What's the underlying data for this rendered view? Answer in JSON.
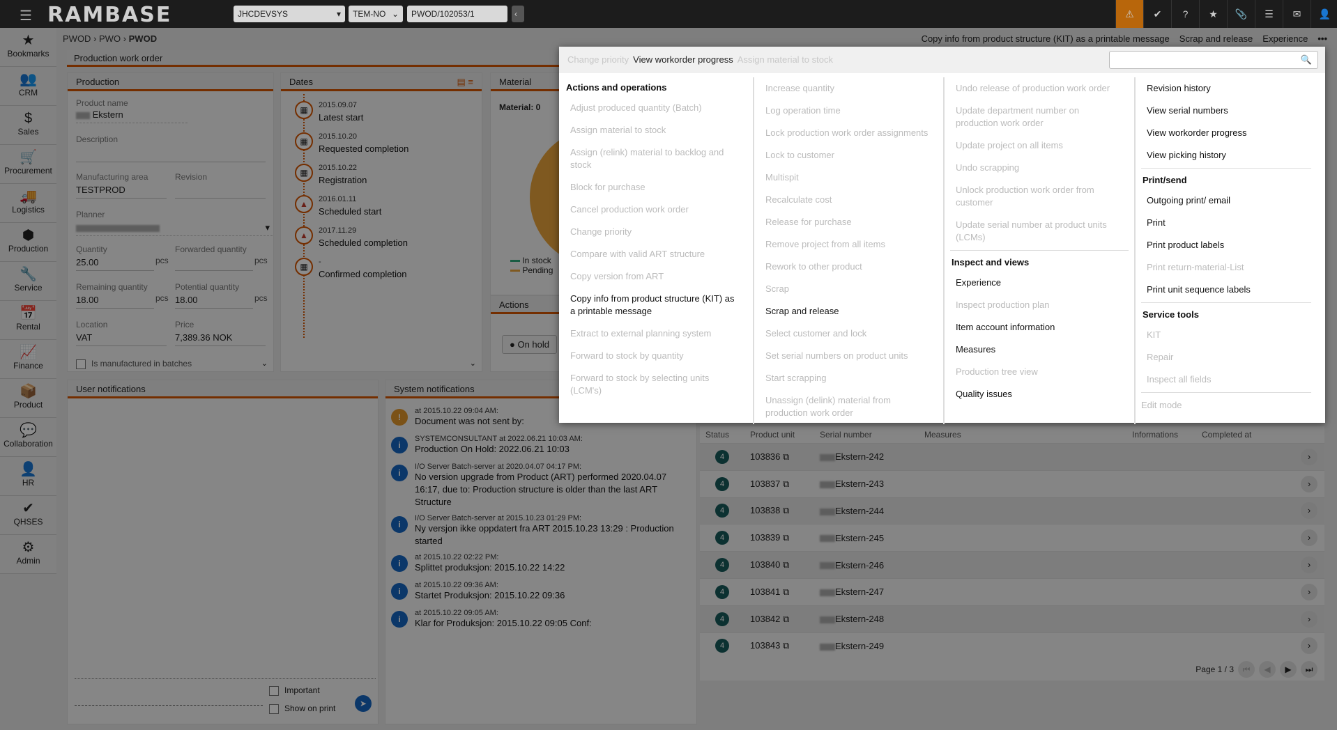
{
  "topbar": {
    "logo": "RAMBASE",
    "company": "JHCDEVSYS",
    "region": "TEM-NO",
    "document": "PWOD/102053/1",
    "back": "‹",
    "icons": [
      {
        "name": "warning-icon",
        "glyph": "⚠",
        "active": true
      },
      {
        "name": "badge-check-icon",
        "glyph": "✔"
      },
      {
        "name": "help-icon",
        "glyph": "?"
      },
      {
        "name": "star-icon",
        "glyph": "★"
      },
      {
        "name": "paperclip-icon",
        "glyph": "📎"
      },
      {
        "name": "list-icon",
        "glyph": "☰"
      },
      {
        "name": "mail-icon",
        "glyph": "✉"
      },
      {
        "name": "user-icon",
        "glyph": "👤"
      }
    ],
    "accent": "#d35400"
  },
  "sidebar": {
    "items": [
      {
        "label": "Bookmarks",
        "icon": "★"
      },
      {
        "label": "CRM",
        "icon": "👥"
      },
      {
        "label": "Sales",
        "icon": "$"
      },
      {
        "label": "Procurement",
        "icon": "🛒"
      },
      {
        "label": "Logistics",
        "icon": "🚚"
      },
      {
        "label": "Production",
        "icon": "⬢"
      },
      {
        "label": "Service",
        "icon": "🔧"
      },
      {
        "label": "Rental",
        "icon": "📅"
      },
      {
        "label": "Finance",
        "icon": "📈"
      },
      {
        "label": "Product",
        "icon": "📦"
      },
      {
        "label": "Collaboration",
        "icon": "💬"
      },
      {
        "label": "HR",
        "icon": "👤"
      },
      {
        "label": "QHSES",
        "icon": "✔"
      },
      {
        "label": "Admin",
        "icon": "⚙"
      }
    ]
  },
  "breadcrumb": [
    "PWOD",
    "PWO",
    "PWOD"
  ],
  "actionbar": [
    "Copy info from product structure (KIT) as a printable message",
    "Scrap and release",
    "Experience",
    "•••"
  ],
  "main": {
    "title": "Production work order",
    "production": {
      "title": "Production",
      "product_name_label": "Product name",
      "product_name": "Ekstern",
      "description_label": "Description",
      "manufacturing_area_label": "Manufacturing area",
      "manufacturing_area": "TESTPROD",
      "revision_label": "Revision",
      "planner_label": "Planner",
      "quantity_label": "Quantity",
      "quantity": "25.00",
      "forwarded_label": "Forwarded quantity",
      "remaining_label": "Remaining quantity",
      "remaining": "18.00",
      "potential_label": "Potential quantity",
      "potential": "18.00",
      "unit": "pcs",
      "location_label": "Location",
      "location": "VAT",
      "price_label": "Price",
      "price": "7,389.36 NOK",
      "batches_label": "Is manufactured in batches"
    },
    "dates": {
      "title": "Dates",
      "items": [
        {
          "date": "2015.09.07",
          "label": "Latest start",
          "icon": "calendar"
        },
        {
          "date": "2015.10.20",
          "label": "Requested completion",
          "icon": "calendar"
        },
        {
          "date": "2015.10.22",
          "label": "Registration",
          "icon": "calendar"
        },
        {
          "date": "2016.01.11",
          "label": "Scheduled start",
          "icon": "warning"
        },
        {
          "date": "2017.11.29",
          "label": "Scheduled completion",
          "icon": "warning"
        },
        {
          "date": "-",
          "label": "Confirmed completion",
          "icon": "calendar"
        }
      ]
    },
    "material": {
      "title": "Material",
      "summary": "Material: 0",
      "legend": [
        "In stock",
        "Pending"
      ]
    },
    "actions": {
      "title": "Actions",
      "onhold": "On hold"
    },
    "user_notifications": {
      "title": "User notifications",
      "important": "Important",
      "show_on_print": "Show on print"
    },
    "system_notifications": {
      "title": "System notifications",
      "items": [
        {
          "type": "warning",
          "header": "at 2015.10.22 09:04 AM:",
          "body": "Document was not sent by:"
        },
        {
          "type": "info",
          "header": "SYSTEMCONSULTANT at 2022.06.21 10:03 AM:",
          "body": "Production On Hold: 2022.06.21 10:03"
        },
        {
          "type": "info",
          "header": "I/O Server Batch-server at 2020.04.07 04:17 PM:",
          "body": "No version upgrade from Product (ART) performed 2020.04.07 16:17, due to: Production structure is older than the last ART Structure"
        },
        {
          "type": "info",
          "header": "I/O Server Batch-server at 2015.10.23 01:29 PM:",
          "body": "Ny versjon ikke oppdatert fra ART 2015.10.23 13:29 : Production started"
        },
        {
          "type": "info",
          "header": "at 2015.10.22 02:22 PM:",
          "body": "Splittet produksjon: 2015.10.22 14:22"
        },
        {
          "type": "info",
          "header": "at 2015.10.22 09:36 AM:",
          "body": "Startet Produksjon: 2015.10.22 09:36"
        },
        {
          "type": "info",
          "header": "at 2015.10.22 09:05 AM:",
          "body": "Klar for Produksjon: 2015.10.22 09:05  Conf:"
        }
      ]
    },
    "grid": {
      "columns": [
        "Status",
        "Product unit",
        "Serial number",
        "Measures",
        "Informations",
        "Completed at"
      ],
      "rows": [
        {
          "status": "4",
          "unit": "103836",
          "serial": "Ekstern-242"
        },
        {
          "status": "4",
          "unit": "103837",
          "serial": "Ekstern-243"
        },
        {
          "status": "4",
          "unit": "103838",
          "serial": "Ekstern-244"
        },
        {
          "status": "4",
          "unit": "103839",
          "serial": "Ekstern-245"
        },
        {
          "status": "4",
          "unit": "103840",
          "serial": "Ekstern-246"
        },
        {
          "status": "4",
          "unit": "103841",
          "serial": "Ekstern-247"
        },
        {
          "status": "4",
          "unit": "103842",
          "serial": "Ekstern-248"
        },
        {
          "status": "4",
          "unit": "103843",
          "serial": "Ekstern-249"
        }
      ],
      "pager": "Page 1 / 3"
    }
  },
  "popup": {
    "recent": [
      {
        "label": "Change priority",
        "disabled": true
      },
      {
        "label": "View workorder progress",
        "disabled": false
      },
      {
        "label": "Assign material to stock",
        "disabled": true
      }
    ],
    "search_value": "",
    "columns": [
      [
        {
          "group": "Actions and operations",
          "items": [
            {
              "label": "Adjust produced quantity (Batch)",
              "disabled": true
            },
            {
              "label": "Assign material to stock",
              "disabled": true
            },
            {
              "label": "Assign (relink) material to backlog and stock",
              "disabled": true
            },
            {
              "label": "Block for purchase",
              "disabled": true
            },
            {
              "label": "Cancel production work order",
              "disabled": true
            },
            {
              "label": "Change priority",
              "disabled": true
            },
            {
              "label": "Compare with valid ART structure",
              "disabled": true
            },
            {
              "label": "Copy version from ART",
              "disabled": true
            },
            {
              "label": "Copy info from product structure (KIT) as a printable message",
              "disabled": false
            },
            {
              "label": "Extract to external planning system",
              "disabled": true
            },
            {
              "label": "Forward to stock by quantity",
              "disabled": true
            },
            {
              "label": "Forward to stock by selecting units (LCM's)",
              "disabled": true
            }
          ]
        }
      ],
      [
        {
          "group": "",
          "items": [
            {
              "label": "Increase quantity",
              "disabled": true
            },
            {
              "label": "Log operation time",
              "disabled": true
            },
            {
              "label": "Lock production work order assignments",
              "disabled": true
            },
            {
              "label": "Lock to customer",
              "disabled": true
            },
            {
              "label": "Multispit",
              "disabled": true
            },
            {
              "label": "Recalculate cost",
              "disabled": true
            },
            {
              "label": "Release for purchase",
              "disabled": true
            },
            {
              "label": "Remove project from all items",
              "disabled": true
            },
            {
              "label": "Rework to other product",
              "disabled": true
            },
            {
              "label": "Scrap",
              "disabled": true
            },
            {
              "label": "Scrap and release",
              "disabled": false
            },
            {
              "label": "Select customer and lock",
              "disabled": true
            },
            {
              "label": "Set serial numbers on product units",
              "disabled": true
            },
            {
              "label": "Start scrapping",
              "disabled": true
            },
            {
              "label": "Unassign (delink) material from production work order",
              "disabled": true
            }
          ]
        }
      ],
      [
        {
          "group": "",
          "items": [
            {
              "label": "Undo release of production work order",
              "disabled": true
            },
            {
              "label": "Update department number on production work order",
              "disabled": true
            },
            {
              "label": "Update project on all items",
              "disabled": true
            },
            {
              "label": "Undo scrapping",
              "disabled": true
            },
            {
              "label": "Unlock production work order from customer",
              "disabled": true
            },
            {
              "label": "Update serial number at product units (LCMs)",
              "disabled": true
            }
          ]
        },
        {
          "group": "Inspect and views",
          "items": [
            {
              "label": "Experience",
              "disabled": false
            },
            {
              "label": "Inspect production plan",
              "disabled": true
            },
            {
              "label": "Item account information",
              "disabled": false
            },
            {
              "label": "Measures",
              "disabled": false
            },
            {
              "label": "Production tree view",
              "disabled": true
            },
            {
              "label": "Quality issues",
              "disabled": false
            }
          ]
        }
      ],
      [
        {
          "group": "",
          "items": [
            {
              "label": "Revision history",
              "disabled": false
            },
            {
              "label": "View serial numbers",
              "disabled": false
            },
            {
              "label": "View workorder progress",
              "disabled": false
            },
            {
              "label": "View picking history",
              "disabled": false
            }
          ]
        },
        {
          "group": "Print/send",
          "items": [
            {
              "label": "Outgoing print/ email",
              "disabled": false
            },
            {
              "label": "Print",
              "disabled": false
            },
            {
              "label": "Print product labels",
              "disabled": false
            },
            {
              "label": "Print return-material-List",
              "disabled": true
            },
            {
              "label": "Print unit sequence labels",
              "disabled": false
            }
          ]
        },
        {
          "group": "Service tools",
          "items": [
            {
              "label": "KIT",
              "disabled": true
            },
            {
              "label": "Repair",
              "disabled": true
            },
            {
              "label": "Inspect all fields",
              "disabled": true
            }
          ]
        },
        {
          "group": "",
          "items": [
            {
              "label": "Edit mode",
              "disabled": true
            }
          ]
        }
      ]
    ]
  }
}
